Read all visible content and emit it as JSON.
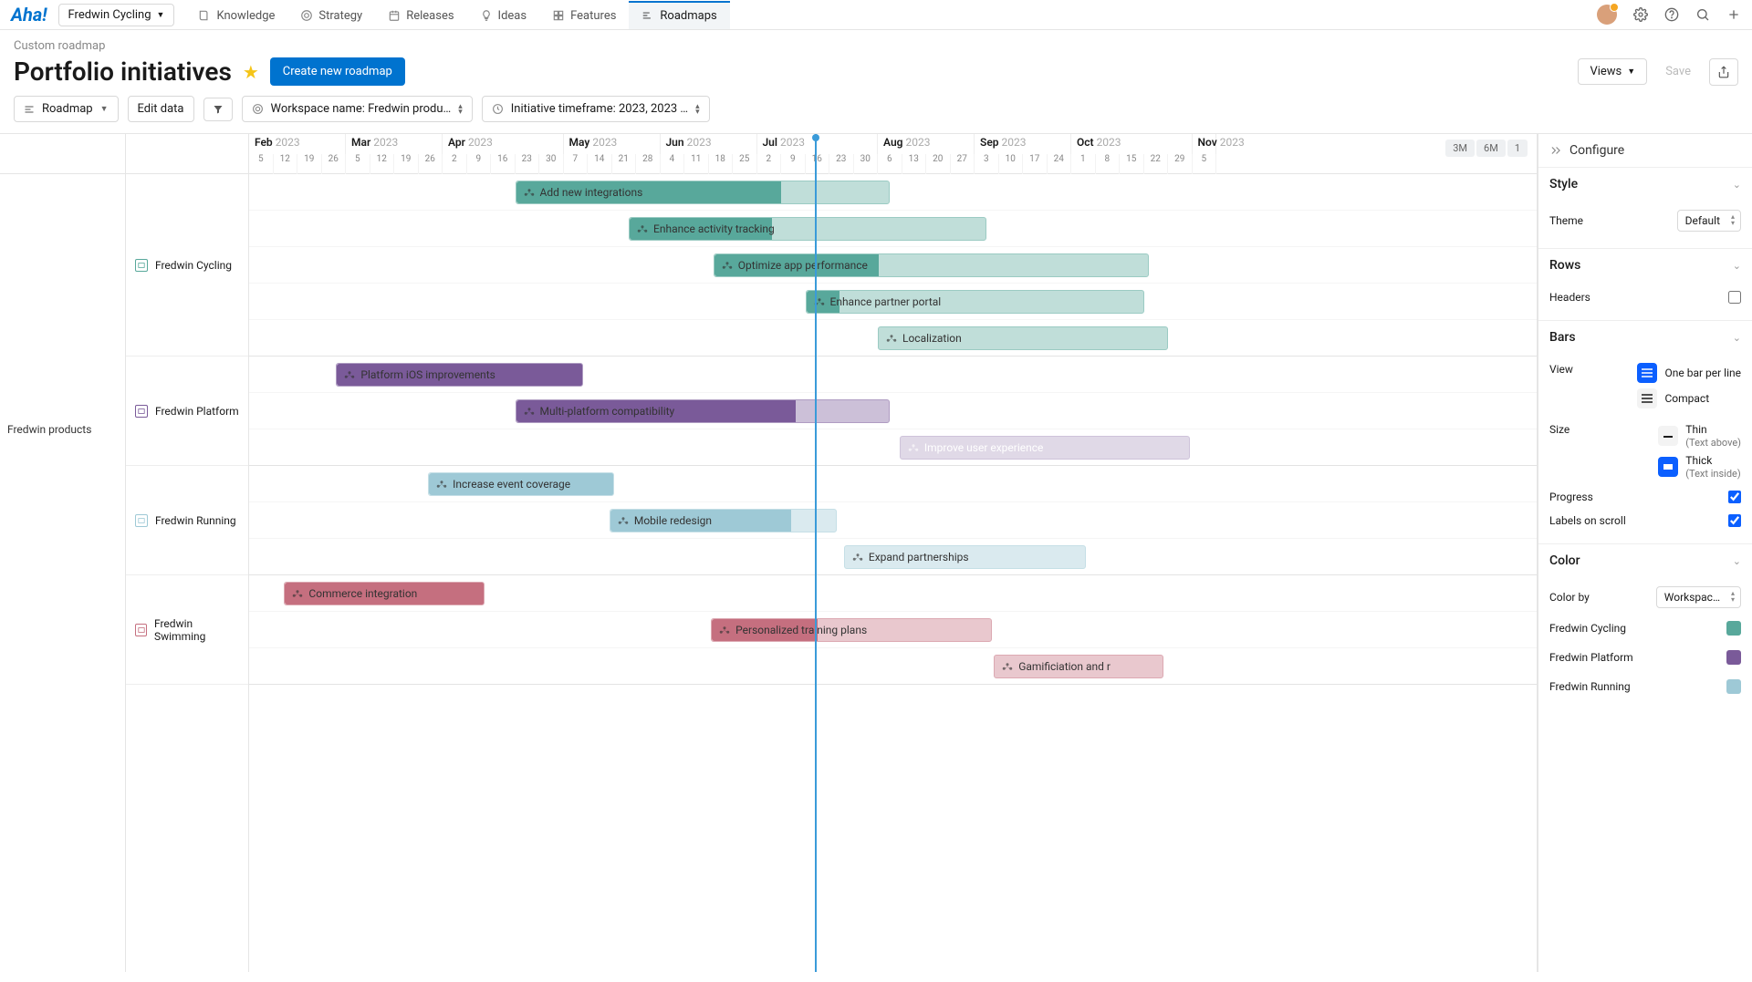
{
  "logo": "Aha!",
  "workspace_switch": "Fredwin Cycling",
  "nav": [
    {
      "label": "Knowledge",
      "icon": "book"
    },
    {
      "label": "Strategy",
      "icon": "target"
    },
    {
      "label": "Releases",
      "icon": "calendar"
    },
    {
      "label": "Ideas",
      "icon": "bulb"
    },
    {
      "label": "Features",
      "icon": "grid"
    },
    {
      "label": "Roadmaps",
      "icon": "roadmap",
      "active": true
    }
  ],
  "breadcrumb": "Custom roadmap",
  "title": "Portfolio initiatives",
  "create_btn": "Create new roadmap",
  "views_btn": "Views",
  "save_btn": "Save",
  "toolbar": {
    "roadmap": "Roadmap",
    "edit_data": "Edit data",
    "workspace_filter": "Workspace name: Fredwin produ…",
    "timeframe_filter": "Initiative timeframe: 2023, 2023 …"
  },
  "zoom": [
    "3M",
    "6M",
    "1"
  ],
  "timeline": {
    "months": [
      {
        "label": "Feb",
        "year": "2023",
        "weeks": [
          "5",
          "12",
          "19",
          "26"
        ]
      },
      {
        "label": "Mar",
        "year": "2023",
        "weeks": [
          "5",
          "12",
          "19",
          "26"
        ]
      },
      {
        "label": "Apr",
        "year": "2023",
        "weeks": [
          "2",
          "9",
          "16",
          "23",
          "30"
        ]
      },
      {
        "label": "May",
        "year": "2023",
        "weeks": [
          "7",
          "14",
          "21",
          "28"
        ]
      },
      {
        "label": "Jun",
        "year": "2023",
        "weeks": [
          "4",
          "11",
          "18",
          "25"
        ]
      },
      {
        "label": "Jul",
        "year": "2023",
        "weeks": [
          "2",
          "9",
          "16",
          "23",
          "30"
        ]
      },
      {
        "label": "Aug",
        "year": "2023",
        "weeks": [
          "6",
          "13",
          "20",
          "27"
        ]
      },
      {
        "label": "Sep",
        "year": "2023",
        "weeks": [
          "3",
          "10",
          "17",
          "24"
        ]
      },
      {
        "label": "Oct",
        "year": "2023",
        "weeks": [
          "1",
          "8",
          "15",
          "22",
          "29"
        ]
      },
      {
        "label": "Nov",
        "year": "2023",
        "weeks": [
          "5"
        ]
      }
    ],
    "week_width": 26.5,
    "today_week_index": 23.4
  },
  "groups": [
    {
      "name": "",
      "rows": [
        {
          "name": "Fredwin Cycling",
          "color": "#58a89b",
          "bars": [
            {
              "label": "Add new integrations",
              "start": 11,
              "span": 15.5,
              "progress": 0.71
            },
            {
              "label": "Enhance activity tracking",
              "start": 15.7,
              "span": 14.8,
              "progress": 0.4
            },
            {
              "label": "Optimize app performance",
              "start": 19.2,
              "span": 18,
              "progress": 0.38
            },
            {
              "label": "Enhance partner portal",
              "start": 23,
              "span": 14,
              "progress": 0.1
            },
            {
              "label": "Localization",
              "start": 26,
              "span": 12,
              "progress": 0
            }
          ]
        },
        {
          "name": "Fredwin Platform",
          "color": "#7a5a99",
          "bars": [
            {
              "label": "Platform iOS improvements",
              "start": 3.6,
              "span": 10.2,
              "progress": 1
            },
            {
              "label": "Multi-platform compatibility",
              "start": 11,
              "span": 15.5,
              "progress": 0.75
            },
            {
              "label": "Improve user experience",
              "start": 26.9,
              "span": 12,
              "progress": 0,
              "faded": true
            }
          ]
        },
        {
          "name": "Fredwin Running",
          "color": "#9ec9d6",
          "bars": [
            {
              "label": "Increase event coverage",
              "start": 7.4,
              "span": 7.7,
              "progress": 1
            },
            {
              "label": "Mobile redesign",
              "start": 14.9,
              "span": 9.4,
              "progress": 0.8
            },
            {
              "label": "Expand partnerships",
              "start": 24.6,
              "span": 10,
              "progress": 0
            }
          ]
        },
        {
          "name": "Fredwin Swimming",
          "color": "#c56f7f",
          "bars": [
            {
              "label": "Commerce integration",
              "start": 1.45,
              "span": 8.3,
              "progress": 1
            },
            {
              "label": "Personalized training plans",
              "start": 19.1,
              "span": 11.6,
              "progress": 0.38
            },
            {
              "label": "Gamificiation and r",
              "start": 30.8,
              "span": 7,
              "progress": 0
            }
          ]
        }
      ]
    }
  ],
  "parent_group": "Fredwin products",
  "config": {
    "title": "Configure",
    "style": {
      "label": "Style",
      "theme_label": "Theme",
      "theme_value": "Default"
    },
    "rows": {
      "label": "Rows",
      "headers_label": "Headers",
      "headers_checked": false
    },
    "bars": {
      "label": "Bars",
      "view_label": "View",
      "view_options": [
        {
          "label": "One bar per line",
          "active": true
        },
        {
          "label": "Compact",
          "active": false
        }
      ],
      "size_label": "Size",
      "size_options": [
        {
          "label": "Thin",
          "sub": "(Text above)",
          "active": false
        },
        {
          "label": "Thick",
          "sub": "(Text inside)",
          "active": true
        }
      ],
      "progress_label": "Progress",
      "progress_checked": true,
      "scroll_label": "Labels on scroll",
      "scroll_checked": true
    },
    "color": {
      "label": "Color",
      "color_by_label": "Color by",
      "color_by_value": "Workspac…",
      "legend": [
        {
          "label": "Fredwin Cycling",
          "color": "#58a89b"
        },
        {
          "label": "Fredwin Platform",
          "color": "#7a5a99"
        },
        {
          "label": "Fredwin Running",
          "color": "#9ec9d6"
        }
      ]
    }
  },
  "chart_data": {
    "type": "gantt",
    "title": "Portfolio initiatives",
    "x_axis": "2023 calendar weeks (Feb–Nov)",
    "today": "early Aug 2023",
    "series": [
      {
        "group": "Fredwin Cycling",
        "item": "Add new integrations",
        "start": "2023-05-01",
        "end": "2023-08-18",
        "progress": 0.71
      },
      {
        "group": "Fredwin Cycling",
        "item": "Enhance activity tracking",
        "start": "2023-06-05",
        "end": "2023-09-18",
        "progress": 0.4
      },
      {
        "group": "Fredwin Cycling",
        "item": "Optimize app performance",
        "start": "2023-07-01",
        "end": "2023-11-05",
        "progress": 0.38
      },
      {
        "group": "Fredwin Cycling",
        "item": "Enhance partner portal",
        "start": "2023-07-28",
        "end": "2023-11-05",
        "progress": 0.1
      },
      {
        "group": "Fredwin Cycling",
        "item": "Localization",
        "start": "2023-08-20",
        "end": "2023-11-05",
        "progress": 0.0
      },
      {
        "group": "Fredwin Platform",
        "item": "Platform iOS improvements",
        "start": "2023-03-01",
        "end": "2023-05-10",
        "progress": 1.0
      },
      {
        "group": "Fredwin Platform",
        "item": "Multi-platform compatibility",
        "start": "2023-05-01",
        "end": "2023-08-18",
        "progress": 0.75
      },
      {
        "group": "Fredwin Platform",
        "item": "Improve user experience",
        "start": "2023-08-25",
        "end": "2023-11-05",
        "progress": 0.0
      },
      {
        "group": "Fredwin Running",
        "item": "Increase event coverage",
        "start": "2023-04-01",
        "end": "2023-05-25",
        "progress": 1.0
      },
      {
        "group": "Fredwin Running",
        "item": "Mobile redesign",
        "start": "2023-05-28",
        "end": "2023-08-01",
        "progress": 0.8
      },
      {
        "group": "Fredwin Running",
        "item": "Expand partnerships",
        "start": "2023-08-05",
        "end": "2023-10-15",
        "progress": 0.0
      },
      {
        "group": "Fredwin Swimming",
        "item": "Commerce integration",
        "start": "2023-02-14",
        "end": "2023-04-12",
        "progress": 1.0
      },
      {
        "group": "Fredwin Swimming",
        "item": "Personalized training plans",
        "start": "2023-07-01",
        "end": "2023-09-20",
        "progress": 0.38
      },
      {
        "group": "Fredwin Swimming",
        "item": "Gamificiation and rewards",
        "start": "2023-10-01",
        "end": "2023-11-05",
        "progress": 0.0
      }
    ]
  }
}
